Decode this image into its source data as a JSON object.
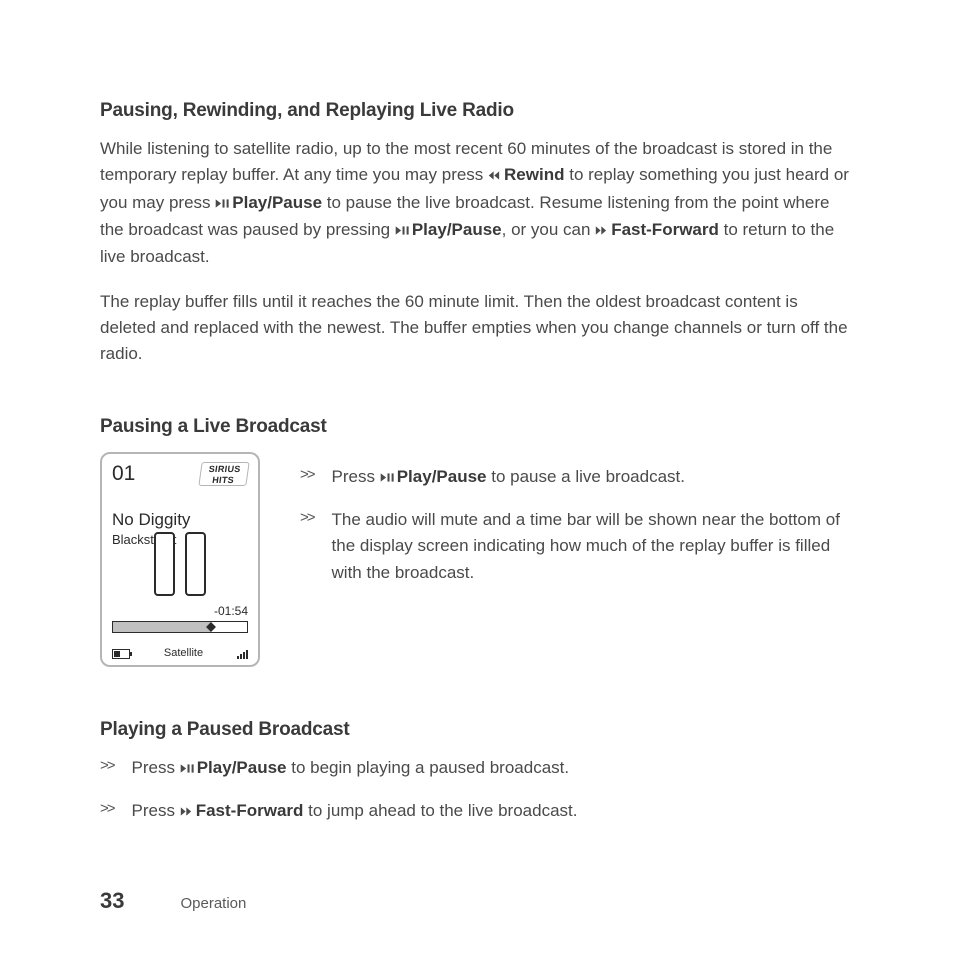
{
  "heading1": "Pausing, Rewinding, and Replaying Live Radio",
  "para1": {
    "t1": "While listening to satellite radio, up to the most recent 60 minutes of the broadcast is stored in the temporary replay buffer. At any time you may press ",
    "rewind": "Rewind",
    "t2": " to replay something you just heard or you may press ",
    "play_pause_a": "Play/Pause",
    "t3": " to pause the live broadcast. Resume listening from the point where the broadcast was paused by pressing ",
    "play_pause_b": "Play/Pause",
    "t4": ", or you can ",
    "fast_forward": "Fast-Forward",
    "t5": " to return to the live broadcast."
  },
  "para2": "The replay buffer fills until it reaches the 60 minute limit.  Then the oldest broadcast content is deleted and replaced with the newest.  The buffer empties when you change channels or turn off the radio.",
  "heading2": "Pausing a Live Broadcast",
  "device": {
    "channel": "01",
    "logo_top": "SIRIUS",
    "logo_bottom": "HITS",
    "song": "No Diggity",
    "artist": "Blackstreet",
    "time": "-01:54",
    "mode": "Satellite"
  },
  "bullets_a": {
    "b1_pre": "Press ",
    "b1_bold": "Play/Pause",
    "b1_post": " to pause a live broadcast.",
    "b2": "The audio will mute and a time bar will be shown near the bottom of the display screen indicating how much of the replay buffer is filled with the broadcast."
  },
  "heading3": "Playing a Paused Broadcast",
  "bullets_b": {
    "b1_pre": "Press ",
    "b1_bold": "Play/Pause",
    "b1_post": " to begin playing a paused broadcast.",
    "b2_pre": "Press ",
    "b2_bold": "Fast-Forward",
    "b2_post": " to jump ahead to the live broadcast."
  },
  "footer": {
    "page": "33",
    "section": "Operation"
  }
}
